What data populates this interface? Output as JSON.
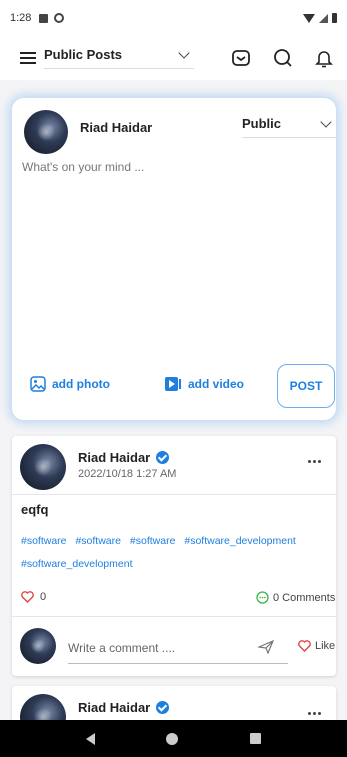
{
  "status_bar": {
    "time": "1:28",
    "icons": [
      "notification-icon",
      "media-icon",
      "wifi-icon",
      "signal-icon",
      "battery-icon"
    ]
  },
  "app_bar": {
    "feed_filter": "Public Posts",
    "icons": [
      "menu-icon",
      "messages-icon",
      "search-icon",
      "notifications-icon"
    ]
  },
  "composer": {
    "user_name": "Riad Haidar",
    "privacy": "Public",
    "placeholder": "What's on your mind ...",
    "add_photo_label": "add photo",
    "add_video_label": "add video",
    "post_label": "POST"
  },
  "posts": [
    {
      "user_name": "Riad Haidar",
      "verified": true,
      "timestamp": "2022/10/18 1:27 AM",
      "text": "eqfq",
      "hashtags": [
        "#software",
        "#software",
        "#software",
        "#software_development",
        "#software_development"
      ],
      "like_count": "0",
      "comments_label": "0 Comments",
      "comment_placeholder": "Write a comment ....",
      "like_label": "Like"
    },
    {
      "user_name": "Riad Haidar",
      "verified": true
    }
  ],
  "colors": {
    "accent": "#1e7fe0",
    "like_red": "#e0454a",
    "comment_green": "#3ab54a"
  }
}
